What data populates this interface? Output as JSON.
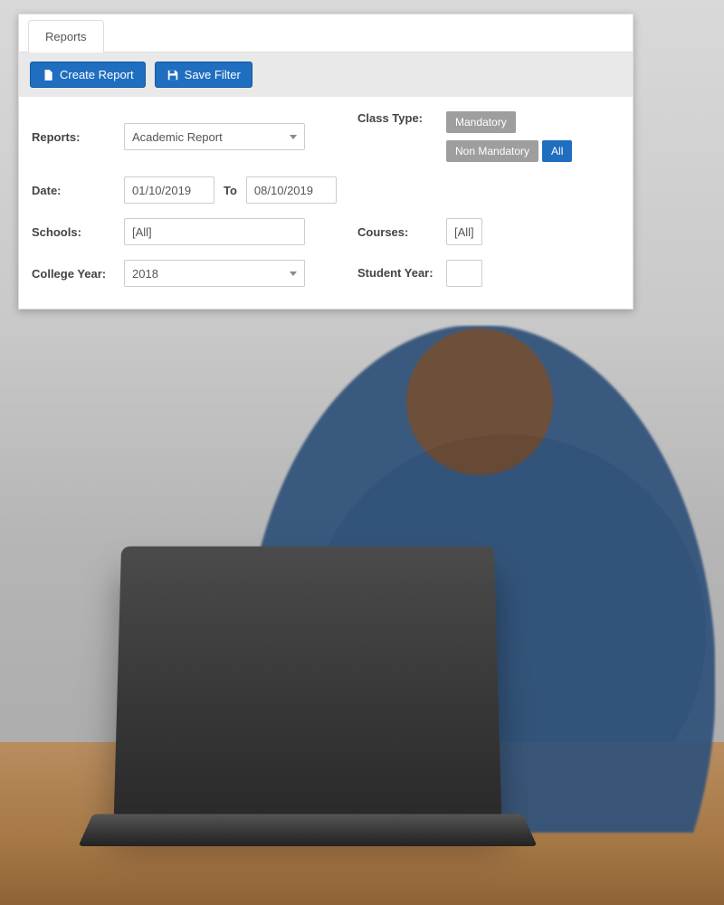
{
  "tab": {
    "label": "Reports"
  },
  "toolbar": {
    "create_report": "Create Report",
    "save_filter": "Save Filter"
  },
  "form": {
    "reports_label": "Reports:",
    "reports_value": "Academic Report",
    "date_label": "Date:",
    "date_from": "01/10/2019",
    "date_to_label": "To",
    "date_to": "08/10/2019",
    "schools_label": "Schools:",
    "schools_value": "[All]",
    "college_year_label": "College Year:",
    "college_year_value": "2018",
    "class_type_label": "Class Type:",
    "class_type_options": {
      "mandatory": "Mandatory",
      "non_mandatory": "Non Mandatory",
      "all": "All"
    },
    "courses_label": "Courses:",
    "courses_value": "[All]",
    "student_year_label": "Student Year:"
  }
}
